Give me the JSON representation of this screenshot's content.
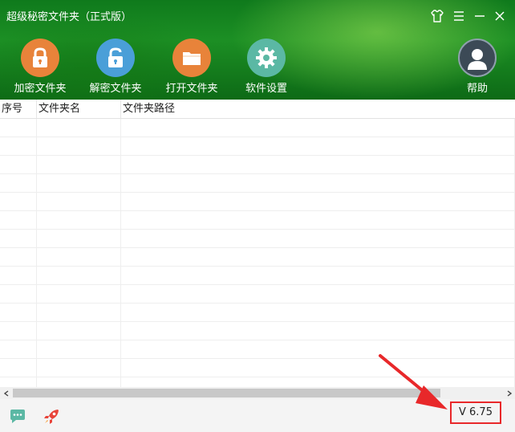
{
  "window": {
    "title": "超级秘密文件夹（正式版）"
  },
  "toolbar": {
    "items": [
      {
        "label": "加密文件夹",
        "icon": "lock-closed-icon",
        "color": "#e8833a"
      },
      {
        "label": "解密文件夹",
        "icon": "lock-open-icon",
        "color": "#4a9fd8"
      },
      {
        "label": "打开文件夹",
        "icon": "folder-icon",
        "color": "#e8833a"
      },
      {
        "label": "软件设置",
        "icon": "gear-icon",
        "color": "#5bb8a4"
      }
    ],
    "help_label": "帮助"
  },
  "table": {
    "columns": [
      "序号",
      "文件夹名",
      "文件夹路径"
    ],
    "rows": []
  },
  "footer": {
    "version": "V 6.75"
  },
  "colors": {
    "header_green": "#1c8f24",
    "highlight_red": "#e8282a"
  }
}
